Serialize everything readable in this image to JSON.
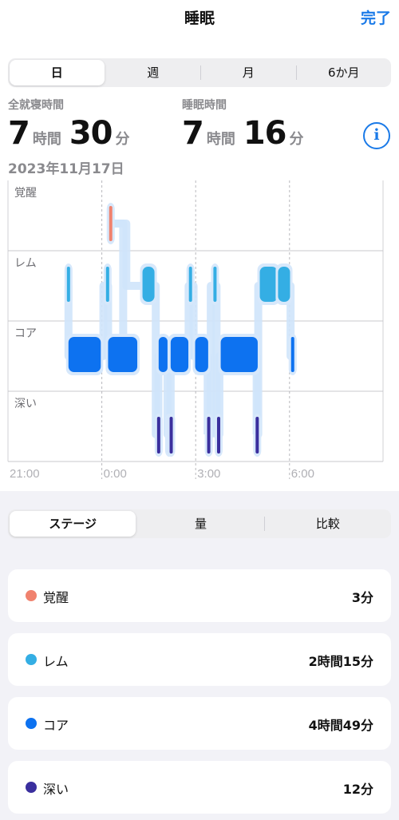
{
  "nav": {
    "title": "睡眠",
    "done": "完了"
  },
  "periodTabs": [
    "日",
    "週",
    "月",
    "6か月"
  ],
  "stats": {
    "inBed": {
      "label": "全就寝時間",
      "hours": "7",
      "hoursUnit": "時間",
      "minutes": "30",
      "minutesUnit": "分"
    },
    "asleep": {
      "label": "睡眠時間",
      "hours": "7",
      "hoursUnit": "時間",
      "minutes": "16",
      "minutesUnit": "分"
    },
    "date": "2023年11月17日"
  },
  "chart_data": {
    "type": "timeline",
    "stages": [
      "覚醒",
      "レム",
      "コア",
      "深い"
    ],
    "xTicks": [
      "21:00",
      "0:00",
      "3:00",
      "6:00"
    ],
    "xRange": [
      "21:00",
      "6:00"
    ],
    "colors": {
      "awake": "#f0826e",
      "rem": "#34aee4",
      "core": "#0d72f0",
      "deep": "#3a2f9e"
    },
    "segments": [
      {
        "stage": "rem",
        "start": "22:53",
        "end": "22:56"
      },
      {
        "stage": "core",
        "start": "22:56",
        "end": "23:58"
      },
      {
        "stage": "core",
        "start": "0:12",
        "end": "1:08"
      },
      {
        "stage": "rem",
        "start": "0:08",
        "end": "0:12"
      },
      {
        "stage": "awake",
        "start": "0:14",
        "end": "0:16"
      },
      {
        "stage": "rem",
        "start": "1:18",
        "end": "1:41"
      },
      {
        "stage": "deep",
        "start": "1:46",
        "end": "1:48"
      },
      {
        "stage": "core",
        "start": "1:49",
        "end": "2:06"
      },
      {
        "stage": "deep",
        "start": "2:06",
        "end": "2:08"
      },
      {
        "stage": "deep",
        "start": "2:10",
        "end": "2:12"
      },
      {
        "stage": "core",
        "start": "2:12",
        "end": "2:46"
      },
      {
        "stage": "rem",
        "start": "2:47",
        "end": "2:53"
      },
      {
        "stage": "core",
        "start": "2:59",
        "end": "3:24"
      },
      {
        "stage": "deep",
        "start": "3:22",
        "end": "3:24"
      },
      {
        "stage": "rem",
        "start": "3:34",
        "end": "3:39"
      },
      {
        "stage": "deep",
        "start": "3:41",
        "end": "3:43"
      },
      {
        "stage": "core",
        "start": "3:48",
        "end": "4:59"
      },
      {
        "stage": "deep",
        "start": "4:55",
        "end": "4:57"
      },
      {
        "stage": "rem",
        "start": "5:03",
        "end": "5:37"
      },
      {
        "stage": "rem",
        "start": "5:38",
        "end": "6:01"
      },
      {
        "stage": "core",
        "start": "6:03",
        "end": "6:08"
      }
    ]
  },
  "viewTabs": [
    "ステージ",
    "量",
    "比較"
  ],
  "summary": [
    {
      "name": "覚醒",
      "value": "3分",
      "color": "#f0826e"
    },
    {
      "name": "レム",
      "value": "2時間15分",
      "color": "#34aee4"
    },
    {
      "name": "コア",
      "value": "4時間49分",
      "color": "#0d72f0"
    },
    {
      "name": "深い",
      "value": "12分",
      "color": "#3a2f9e"
    }
  ]
}
